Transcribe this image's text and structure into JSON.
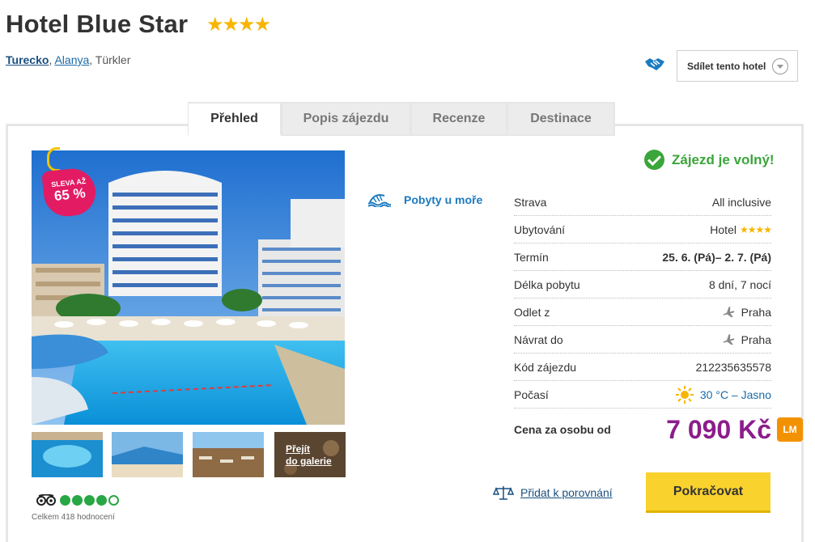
{
  "hotel": {
    "name": "Hotel Blue Star",
    "stars": "★★★★"
  },
  "location": {
    "country": "Turecko",
    "city": "Alanya",
    "area": "Türkler"
  },
  "share": {
    "label": "Sdílet tento hotel"
  },
  "tabs": [
    {
      "label": "Přehled",
      "active": true
    },
    {
      "label": "Popis zájezdu",
      "active": false
    },
    {
      "label": "Recenze",
      "active": false
    },
    {
      "label": "Destinace",
      "active": false
    }
  ],
  "gallery": {
    "badge_line1": "SLEVA AŽ",
    "badge_line2": "65 %",
    "gallery_link_line1": "Přejít",
    "gallery_link_line2": "do galerie"
  },
  "tripadvisor": {
    "rating_filled": 4,
    "rating_max": 5,
    "count_text": "Celkem 418 hodnocení"
  },
  "feature": {
    "label": "Pobyty u moře"
  },
  "status": {
    "label": "Zájezd je volný!"
  },
  "details": [
    {
      "label": "Strava",
      "value": "All inclusive"
    },
    {
      "label": "Ubytování",
      "value": "Hotel",
      "stars": "★★★★"
    },
    {
      "label": "Termín",
      "value": "25. 6. (Pá)– 2. 7. (Pá)"
    },
    {
      "label": "Délka pobytu",
      "value": "8 dní, 7 nocí"
    },
    {
      "label": "Odlet z",
      "value": "Praha"
    },
    {
      "label": "Návrat do",
      "value": "Praha"
    },
    {
      "label": "Kód zájezdu",
      "value": "212235635578"
    },
    {
      "label": "Počasí",
      "value": "30 °C – Jasno"
    }
  ],
  "price": {
    "label": "Cena za osobu od",
    "value": "7 090 Kč",
    "badge": "LM"
  },
  "actions": {
    "compare_label": "Přidat k porovnání",
    "continue_label": "Pokračovat"
  },
  "colors": {
    "accent_purple": "#8c1d8c",
    "button_yellow": "#f9d22d",
    "success_green": "#3aa53a",
    "sale_pink": "#e31b63",
    "lm_orange": "#f39200"
  }
}
